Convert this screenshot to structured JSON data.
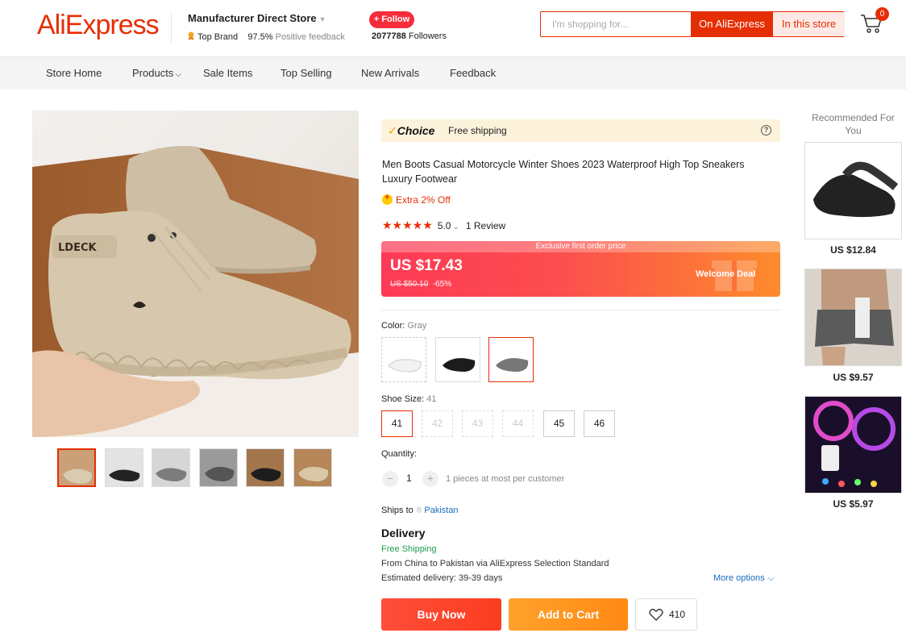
{
  "header": {
    "logo": "AliExpress",
    "store_name": "Manufacturer Direct Store",
    "top_brand": "Top Brand",
    "positive_pct": "97.5%",
    "positive_label": "Positive feedback",
    "follow_label": "+ Follow",
    "followers_count": "2077788",
    "followers_label": "Followers",
    "search_placeholder": "I'm shopping for...",
    "search_on_ali": "On AliExpress",
    "search_in_store": "In this store",
    "cart_count": "0"
  },
  "nav": {
    "items": [
      "Store Home",
      "Products",
      "Sale Items",
      "Top Selling",
      "New Arrivals",
      "Feedback"
    ]
  },
  "product": {
    "choice_label": "Choice",
    "free_shipping": "Free shipping",
    "title": "Men Boots Casual Motorcycle Winter Shoes 2023 Waterproof High Top Sneakers Luxury Footwear",
    "extra_off": "Extra 2% Off",
    "stars": "★★★★★",
    "rating": "5.0",
    "rating_caret": "⌄",
    "reviews": "1 Review",
    "deal_banner": "Exclusive first order price",
    "price": "US $17.43",
    "old_price": "US $50.10",
    "discount": "-65%",
    "welcome_deal": "Welcome Deal",
    "color_label": "Color: ",
    "color_value": "Gray",
    "size_label": "Shoe Size: ",
    "size_value": "41",
    "sizes": [
      "41",
      "42",
      "43",
      "44",
      "45",
      "46"
    ],
    "quantity_label": "Quantity:",
    "quantity": "1",
    "quantity_note": "1 pieces at most per customer",
    "ships_to_label": "Ships to",
    "ships_to_country": "Pakistan",
    "delivery_title": "Delivery",
    "delivery_free": "Free Shipping",
    "delivery_from": "From China to Pakistan via AliExpress Selection Standard",
    "delivery_estimate": "Estimated delivery: 39-39 days",
    "more_options": "More options",
    "buy_now": "Buy Now",
    "add_to_cart": "Add to Cart",
    "wishlist_count": "410"
  },
  "recommended": {
    "title": "Recommended For You",
    "items": [
      {
        "price": "US $12.84"
      },
      {
        "price": "US $9.57"
      },
      {
        "price": "US $5.97"
      }
    ]
  },
  "colors": {
    "brand": "#e62e04",
    "accent_orange": "#ff8a14",
    "link": "#1a6bc2",
    "free_green": "#1f9e4d"
  }
}
